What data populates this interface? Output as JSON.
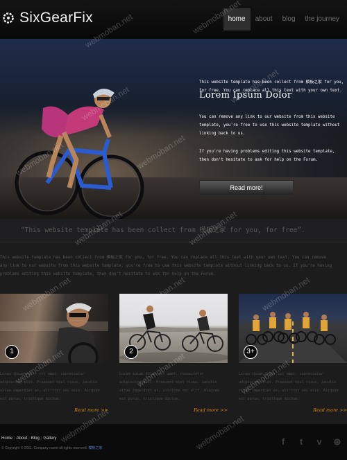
{
  "header": {
    "logo_text": "SixGearFix",
    "nav": [
      {
        "label": "home",
        "active": true
      },
      {
        "label": "about",
        "active": false
      },
      {
        "label": "blog",
        "active": false
      },
      {
        "label": "the journey",
        "active": false
      }
    ]
  },
  "hero": {
    "title": "Lorem Ipsum Dolor",
    "paragraphs": [
      "This website template has been collect from 模板之家 for you, for free. You can replace all this text with your own text.",
      "You can remove any link to our website from this website template, you're free to use this website template without linking back to us.",
      "If you're having problems editing this website template, then don't hesitate to ask for help on the Forum."
    ],
    "button_label": "Read more!"
  },
  "quote": "“This website template has been collect from 模板之家 for you, for free”.",
  "intro": [
    "This website template has been collect from 模板之家 for you, for free. You can replace all this text with your own text. You can remove",
    "any link to our website from this website template, you're free to use this website template without linking back to us. If you're having",
    "problems editing this website template, then don't hesitate to ask for help on the Forum."
  ],
  "cards": [
    {
      "number": "1",
      "text": "Lorem ipsum dolor sit amet, consectetur adipiscing elit. Praesent nisl risus, iaculis vitae imperdiet at, ultrices nec elit. Aliquam est purus, tristique dictum.",
      "more": "Read more >>"
    },
    {
      "number": "2",
      "text": "Lorem ipsum dolor sit amet, consectetur adipiscing elit. Praesent nisl risus, iaculis vitae imperdiet at, ultrices nec elit. Aliquam est purus, tristique dictum.",
      "more": "Read more >>"
    },
    {
      "number": "3+",
      "text": "Lorem ipsum dolor sit amet, consectetur adipiscing elit. Praesent nisl risus, iaculis vitae imperdiet at, ultrices nec elit. Aliquam est purus, tristique dictum.",
      "more": "Read more >>"
    }
  ],
  "footer": {
    "links": [
      "Home",
      "About",
      "Blog",
      "Gallery"
    ],
    "copyright": "© Copyright © 2011. Company name all rights reserved.",
    "copyright_link": "模板之家",
    "social": [
      "facebook-icon",
      "twitter-icon",
      "vimeo-icon",
      "rss-icon"
    ]
  },
  "watermark": "webmoban.net",
  "colors": {
    "accent": "#d7880f",
    "nav_active_bg": "#2f2f30",
    "background": "#1c1c1d"
  }
}
